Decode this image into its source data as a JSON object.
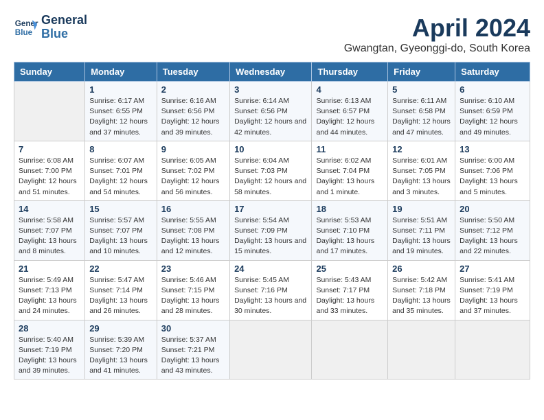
{
  "header": {
    "logo_line1": "General",
    "logo_line2": "Blue",
    "month_title": "April 2024",
    "location": "Gwangtan, Gyeonggi-do, South Korea"
  },
  "weekdays": [
    "Sunday",
    "Monday",
    "Tuesday",
    "Wednesday",
    "Thursday",
    "Friday",
    "Saturday"
  ],
  "weeks": [
    [
      {
        "day": "",
        "empty": true
      },
      {
        "day": "1",
        "sunrise": "Sunrise: 6:17 AM",
        "sunset": "Sunset: 6:55 PM",
        "daylight": "Daylight: 12 hours and 37 minutes."
      },
      {
        "day": "2",
        "sunrise": "Sunrise: 6:16 AM",
        "sunset": "Sunset: 6:56 PM",
        "daylight": "Daylight: 12 hours and 39 minutes."
      },
      {
        "day": "3",
        "sunrise": "Sunrise: 6:14 AM",
        "sunset": "Sunset: 6:56 PM",
        "daylight": "Daylight: 12 hours and 42 minutes."
      },
      {
        "day": "4",
        "sunrise": "Sunrise: 6:13 AM",
        "sunset": "Sunset: 6:57 PM",
        "daylight": "Daylight: 12 hours and 44 minutes."
      },
      {
        "day": "5",
        "sunrise": "Sunrise: 6:11 AM",
        "sunset": "Sunset: 6:58 PM",
        "daylight": "Daylight: 12 hours and 47 minutes."
      },
      {
        "day": "6",
        "sunrise": "Sunrise: 6:10 AM",
        "sunset": "Sunset: 6:59 PM",
        "daylight": "Daylight: 12 hours and 49 minutes."
      }
    ],
    [
      {
        "day": "7",
        "sunrise": "Sunrise: 6:08 AM",
        "sunset": "Sunset: 7:00 PM",
        "daylight": "Daylight: 12 hours and 51 minutes."
      },
      {
        "day": "8",
        "sunrise": "Sunrise: 6:07 AM",
        "sunset": "Sunset: 7:01 PM",
        "daylight": "Daylight: 12 hours and 54 minutes."
      },
      {
        "day": "9",
        "sunrise": "Sunrise: 6:05 AM",
        "sunset": "Sunset: 7:02 PM",
        "daylight": "Daylight: 12 hours and 56 minutes."
      },
      {
        "day": "10",
        "sunrise": "Sunrise: 6:04 AM",
        "sunset": "Sunset: 7:03 PM",
        "daylight": "Daylight: 12 hours and 58 minutes."
      },
      {
        "day": "11",
        "sunrise": "Sunrise: 6:02 AM",
        "sunset": "Sunset: 7:04 PM",
        "daylight": "Daylight: 13 hours and 1 minute."
      },
      {
        "day": "12",
        "sunrise": "Sunrise: 6:01 AM",
        "sunset": "Sunset: 7:05 PM",
        "daylight": "Daylight: 13 hours and 3 minutes."
      },
      {
        "day": "13",
        "sunrise": "Sunrise: 6:00 AM",
        "sunset": "Sunset: 7:06 PM",
        "daylight": "Daylight: 13 hours and 5 minutes."
      }
    ],
    [
      {
        "day": "14",
        "sunrise": "Sunrise: 5:58 AM",
        "sunset": "Sunset: 7:07 PM",
        "daylight": "Daylight: 13 hours and 8 minutes."
      },
      {
        "day": "15",
        "sunrise": "Sunrise: 5:57 AM",
        "sunset": "Sunset: 7:07 PM",
        "daylight": "Daylight: 13 hours and 10 minutes."
      },
      {
        "day": "16",
        "sunrise": "Sunrise: 5:55 AM",
        "sunset": "Sunset: 7:08 PM",
        "daylight": "Daylight: 13 hours and 12 minutes."
      },
      {
        "day": "17",
        "sunrise": "Sunrise: 5:54 AM",
        "sunset": "Sunset: 7:09 PM",
        "daylight": "Daylight: 13 hours and 15 minutes."
      },
      {
        "day": "18",
        "sunrise": "Sunrise: 5:53 AM",
        "sunset": "Sunset: 7:10 PM",
        "daylight": "Daylight: 13 hours and 17 minutes."
      },
      {
        "day": "19",
        "sunrise": "Sunrise: 5:51 AM",
        "sunset": "Sunset: 7:11 PM",
        "daylight": "Daylight: 13 hours and 19 minutes."
      },
      {
        "day": "20",
        "sunrise": "Sunrise: 5:50 AM",
        "sunset": "Sunset: 7:12 PM",
        "daylight": "Daylight: 13 hours and 22 minutes."
      }
    ],
    [
      {
        "day": "21",
        "sunrise": "Sunrise: 5:49 AM",
        "sunset": "Sunset: 7:13 PM",
        "daylight": "Daylight: 13 hours and 24 minutes."
      },
      {
        "day": "22",
        "sunrise": "Sunrise: 5:47 AM",
        "sunset": "Sunset: 7:14 PM",
        "daylight": "Daylight: 13 hours and 26 minutes."
      },
      {
        "day": "23",
        "sunrise": "Sunrise: 5:46 AM",
        "sunset": "Sunset: 7:15 PM",
        "daylight": "Daylight: 13 hours and 28 minutes."
      },
      {
        "day": "24",
        "sunrise": "Sunrise: 5:45 AM",
        "sunset": "Sunset: 7:16 PM",
        "daylight": "Daylight: 13 hours and 30 minutes."
      },
      {
        "day": "25",
        "sunrise": "Sunrise: 5:43 AM",
        "sunset": "Sunset: 7:17 PM",
        "daylight": "Daylight: 13 hours and 33 minutes."
      },
      {
        "day": "26",
        "sunrise": "Sunrise: 5:42 AM",
        "sunset": "Sunset: 7:18 PM",
        "daylight": "Daylight: 13 hours and 35 minutes."
      },
      {
        "day": "27",
        "sunrise": "Sunrise: 5:41 AM",
        "sunset": "Sunset: 7:19 PM",
        "daylight": "Daylight: 13 hours and 37 minutes."
      }
    ],
    [
      {
        "day": "28",
        "sunrise": "Sunrise: 5:40 AM",
        "sunset": "Sunset: 7:19 PM",
        "daylight": "Daylight: 13 hours and 39 minutes."
      },
      {
        "day": "29",
        "sunrise": "Sunrise: 5:39 AM",
        "sunset": "Sunset: 7:20 PM",
        "daylight": "Daylight: 13 hours and 41 minutes."
      },
      {
        "day": "30",
        "sunrise": "Sunrise: 5:37 AM",
        "sunset": "Sunset: 7:21 PM",
        "daylight": "Daylight: 13 hours and 43 minutes."
      },
      {
        "day": "",
        "empty": true
      },
      {
        "day": "",
        "empty": true
      },
      {
        "day": "",
        "empty": true
      },
      {
        "day": "",
        "empty": true
      }
    ]
  ]
}
